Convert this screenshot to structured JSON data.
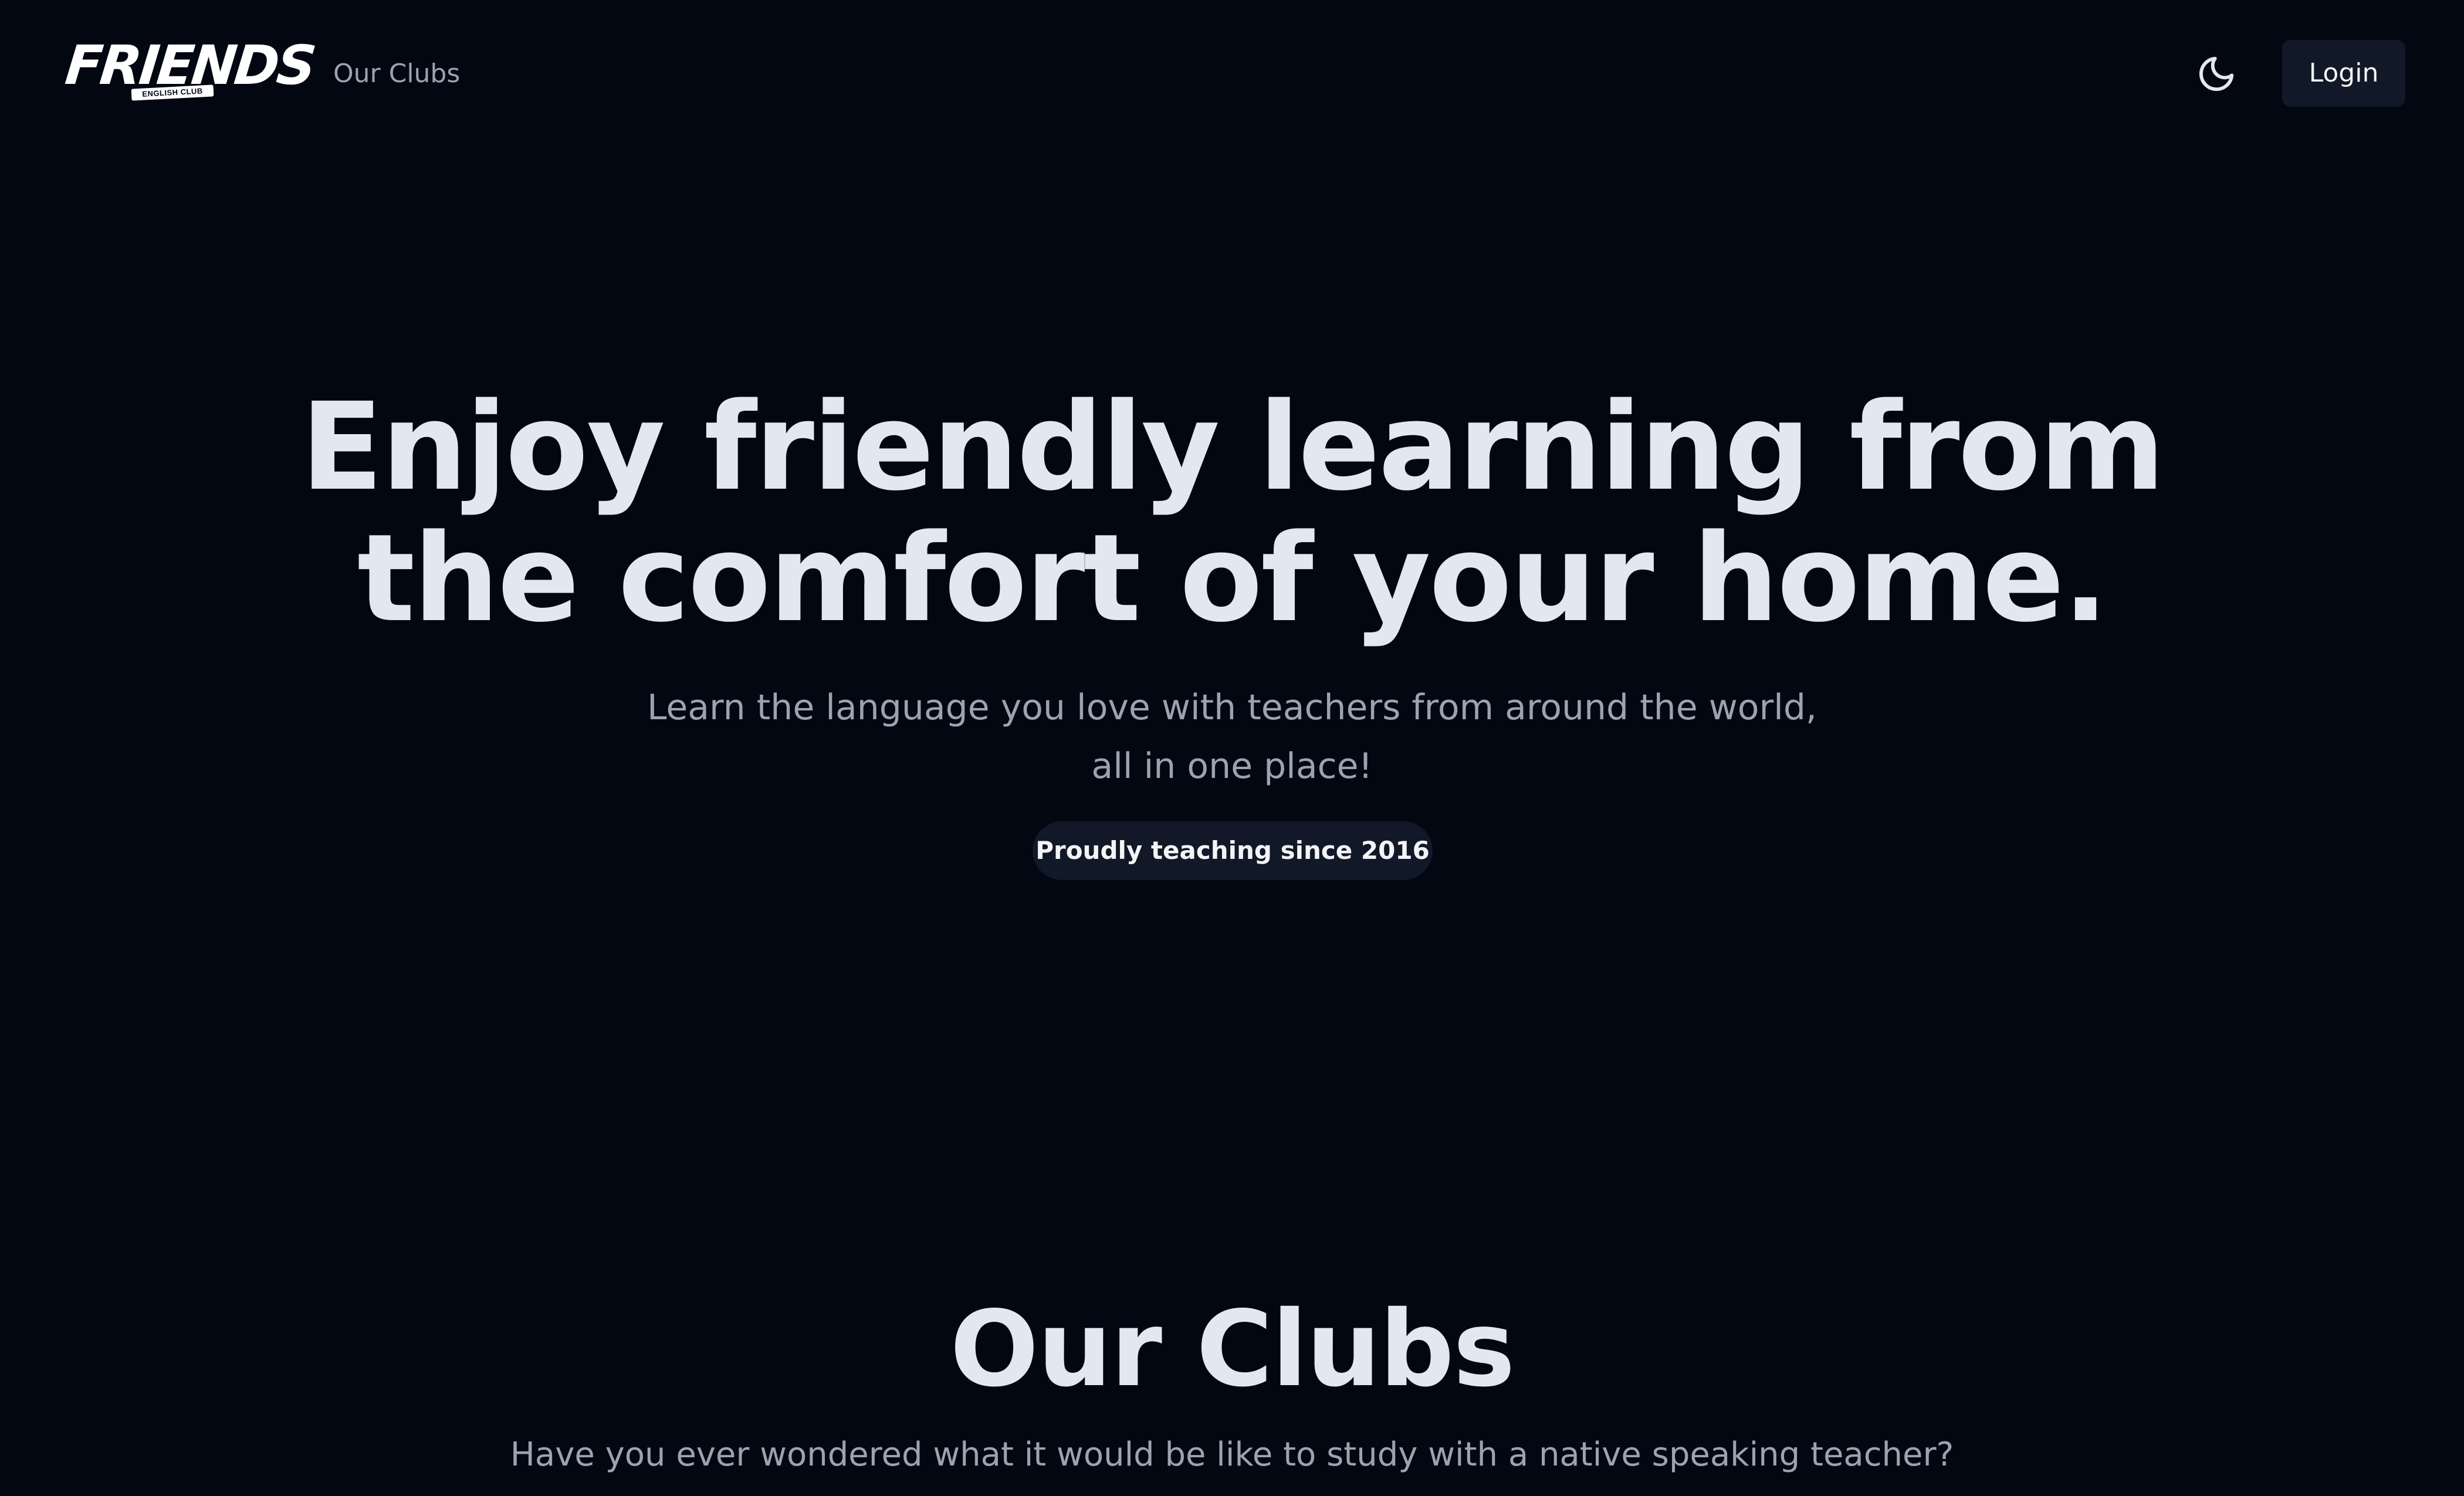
{
  "navbar": {
    "logo": {
      "wordmark": "FRIENDS",
      "tagline": "ENGLISH CLUB"
    },
    "links": [
      {
        "label": "Our Clubs"
      }
    ],
    "theme_toggle_icon": "moon-icon",
    "login_label": "Login"
  },
  "hero": {
    "title_line1": "Enjoy friendly learning from",
    "title_line2": "the comfort of your home.",
    "subtitle_line1": "Learn the language you love with teachers from around the world,",
    "subtitle_line2": "all in one place!",
    "badge": "Proudly teaching since 2016"
  },
  "clubs": {
    "title": "Our Clubs",
    "subtitle": "Have you ever wondered what it would be like to study with a native speaking teacher?"
  },
  "colors": {
    "background": "#030712",
    "heading": "#e2e8f0",
    "muted": "#9ca3af",
    "surface": "#111827"
  }
}
